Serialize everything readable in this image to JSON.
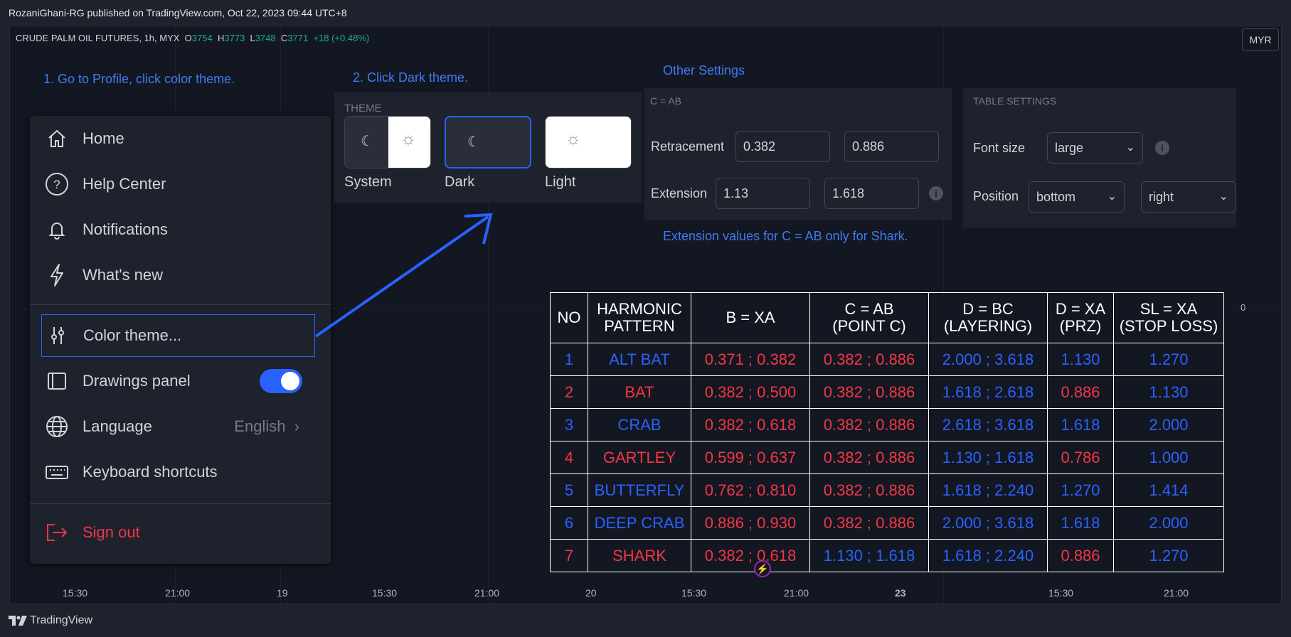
{
  "publish_line": "RozaniGhani-RG published on TradingView.com, Oct 22, 2023 09:44 UTC+8",
  "legend": {
    "symbol": "CRUDE PALM OIL FUTURES, 1h, MYX",
    "o_label": "O",
    "o_val": "3754",
    "h_label": "H",
    "h_val": "3773",
    "l_label": "L",
    "l_val": "3748",
    "c_label": "C",
    "c_val": "3771",
    "change": "+18 (+0.48%)"
  },
  "currency_button": "MYR",
  "instructions": {
    "step1": "1. Go to Profile, click color theme.",
    "step2": "2. Click Dark theme.",
    "other": "Other Settings",
    "extension_note": "Extension values for C = AB only for Shark."
  },
  "menu": {
    "items": [
      {
        "label": "Home",
        "icon": "home-icon"
      },
      {
        "label": "Help Center",
        "icon": "help-icon"
      },
      {
        "label": "Notifications",
        "icon": "bell-icon"
      },
      {
        "label": "What's new",
        "icon": "lightning-icon"
      }
    ],
    "color_theme": "Color theme...",
    "drawings_panel": "Drawings panel",
    "language": "Language",
    "language_value": "English",
    "keyboard_shortcuts": "Keyboard shortcuts",
    "sign_out": "Sign out"
  },
  "theme": {
    "heading": "THEME",
    "options": [
      "System",
      "Dark",
      "Light"
    ],
    "selected": "Dark"
  },
  "settings": {
    "heading": "C = AB",
    "retracement_label": "Retracement",
    "retracement_1": "0.382",
    "retracement_2": "0.886",
    "extension_label": "Extension",
    "extension_1": "1.13",
    "extension_2": "1.618"
  },
  "table_settings": {
    "heading": "TABLE SETTINGS",
    "font_size_label": "Font size",
    "font_size_value": "large",
    "position_label": "Position",
    "position_v": "bottom",
    "position_h": "right"
  },
  "harmonic_table": {
    "headers": [
      [
        "NO"
      ],
      [
        "HARMONIC",
        "PATTERN"
      ],
      [
        "B = XA"
      ],
      [
        "C = AB",
        "(POINT C)"
      ],
      [
        "D = BC",
        "(LAYERING)"
      ],
      [
        "D = XA",
        "(PRZ)"
      ],
      [
        "SL = XA",
        "(STOP LOSS)"
      ]
    ],
    "rows": [
      {
        "color": "#2962ff",
        "cells": [
          "1",
          "ALT BAT",
          "0.371 ; 0.382",
          "0.382 ; 0.886",
          "2.000 ; 3.618",
          "1.130",
          "1.270"
        ],
        "cell_colors": [
          "blue",
          "blue",
          "red",
          "red",
          "blue",
          "blue",
          "blue"
        ]
      },
      {
        "color": "#f23645",
        "cells": [
          "2",
          "BAT",
          "0.382 ; 0.500",
          "0.382 ; 0.886",
          "1.618 ; 2.618",
          "0.886",
          "1.130"
        ],
        "cell_colors": [
          "red",
          "red",
          "red",
          "red",
          "blue",
          "red",
          "blue"
        ]
      },
      {
        "color": "#2962ff",
        "cells": [
          "3",
          "CRAB",
          "0.382 ; 0.618",
          "0.382 ; 0.886",
          "2.618 ; 3.618",
          "1.618",
          "2.000"
        ],
        "cell_colors": [
          "blue",
          "blue",
          "red",
          "red",
          "blue",
          "blue",
          "blue"
        ]
      },
      {
        "color": "#f23645",
        "cells": [
          "4",
          "GARTLEY",
          "0.599 ; 0.637",
          "0.382 ; 0.886",
          "1.130 ; 1.618",
          "0.786",
          "1.000"
        ],
        "cell_colors": [
          "red",
          "red",
          "red",
          "red",
          "blue",
          "red",
          "blue"
        ]
      },
      {
        "color": "#2962ff",
        "cells": [
          "5",
          "BUTTERFLY",
          "0.762 ; 0.810",
          "0.382 ; 0.886",
          "1.618 ; 2.240",
          "1.270",
          "1.414"
        ],
        "cell_colors": [
          "blue",
          "blue",
          "red",
          "red",
          "blue",
          "blue",
          "blue"
        ]
      },
      {
        "color": "#2962ff",
        "cells": [
          "6",
          "DEEP CRAB",
          "0.886 ; 0.930",
          "0.382 ; 0.886",
          "2.000 ; 3.618",
          "1.618",
          "2.000"
        ],
        "cell_colors": [
          "blue",
          "blue",
          "red",
          "red",
          "blue",
          "blue",
          "blue"
        ]
      },
      {
        "color": "#f23645",
        "cells": [
          "7",
          "SHARK",
          "0.382 ; 0.618",
          "1.130 ; 1.618",
          "1.618 ; 2.240",
          "0.886",
          "1.270"
        ],
        "cell_colors": [
          "red",
          "red",
          "red",
          "blue",
          "blue",
          "red",
          "blue"
        ]
      }
    ]
  },
  "x_axis": [
    "15:30",
    "21:00",
    "19",
    "15:30",
    "21:00",
    "20",
    "15:30",
    "21:00",
    "23",
    "15:30",
    "21:00"
  ],
  "price_axis_label": "0",
  "footer_brand": "TradingView",
  "colors": {
    "accent": "#2962ff",
    "red": "#f23645",
    "green": "#22ab94"
  }
}
